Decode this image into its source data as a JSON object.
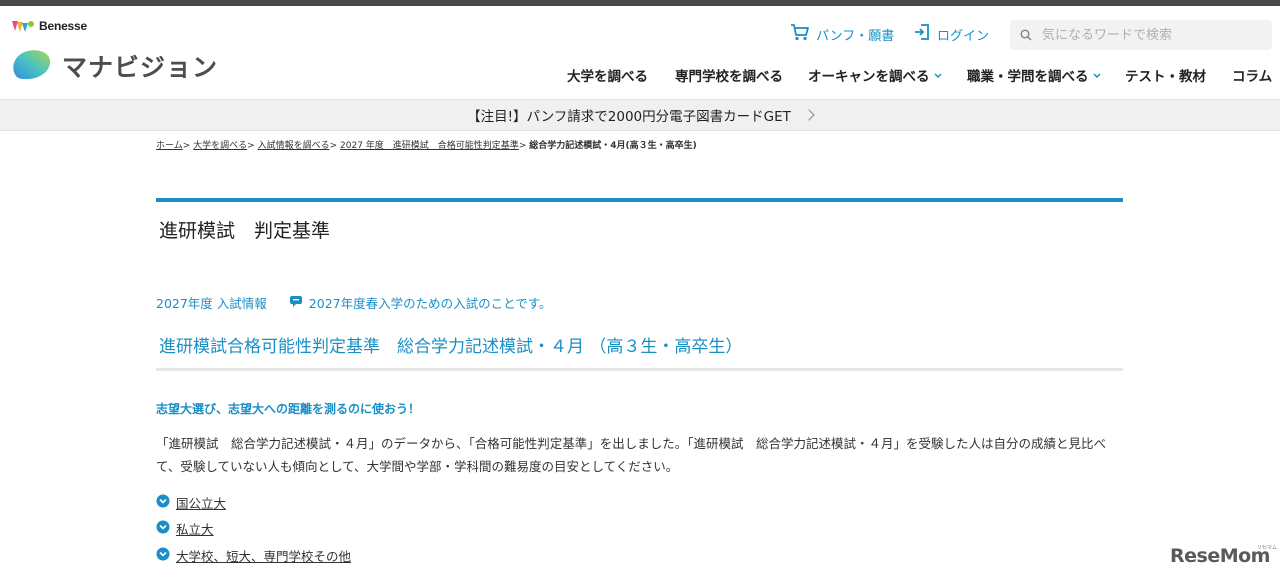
{
  "header": {
    "brand": "Benesse",
    "logo_text": "マナビジョン",
    "util_links": {
      "pamphlet": "パンフ・願書",
      "login": "ログイン"
    },
    "search": {
      "placeholder": "気になるワードで検索"
    },
    "nav": [
      {
        "label": "大学を調べる",
        "dropdown": false
      },
      {
        "label": "専門学校を調べる",
        "dropdown": false
      },
      {
        "label": "オーキャンを調べる",
        "dropdown": true
      },
      {
        "label": "職業・学問を調べる",
        "dropdown": true
      },
      {
        "label": "テスト・教材",
        "dropdown": false
      },
      {
        "label": "コラム",
        "dropdown": false
      }
    ]
  },
  "notice": {
    "text": "【注目!】パンフ請求で2000円分電子図書カードGET"
  },
  "breadcrumb": {
    "items": [
      "ホーム",
      "大学を調べる",
      "入試情報を調べる",
      "2027 年度　進研模試　合格可能性判定基準"
    ],
    "separator": ">",
    "current": "総合学力記述模試・4月(高３生・高卒生)"
  },
  "page": {
    "title": "進研模試　判定基準",
    "year_label": "2027年度 入試情報",
    "year_note": "2027年度春入学のための入試のことです。",
    "subtitle": "進研模試合格可能性判定基準　総合学力記述模試・４月 （高３生・高卒生）",
    "lead": "志望大選び、志望大への距離を測るのに使おう！",
    "description": "「進研模試　総合学力記述模試・４月」のデータから、「合格可能性判定基準」を出しました。「進研模試　総合学力記述模試・４月」を受験した人は自分の成績と見比べて、受験していない人も傾向として、大学間や学部・学科間の難易度の目安としてください。",
    "links": [
      "国公立大",
      "私立大",
      "大学校、短大、専門学校その他"
    ]
  },
  "watermark": {
    "text": "ReseMom",
    "small": "リセマム"
  },
  "colors": {
    "accent": "#1a8fc6",
    "text": "#333333",
    "notice_bg": "#f0f0f0"
  },
  "icons": [
    "cart-icon",
    "login-icon",
    "search-icon",
    "chevron-down-icon",
    "chevron-right-icon",
    "speech-bubble-icon"
  ]
}
